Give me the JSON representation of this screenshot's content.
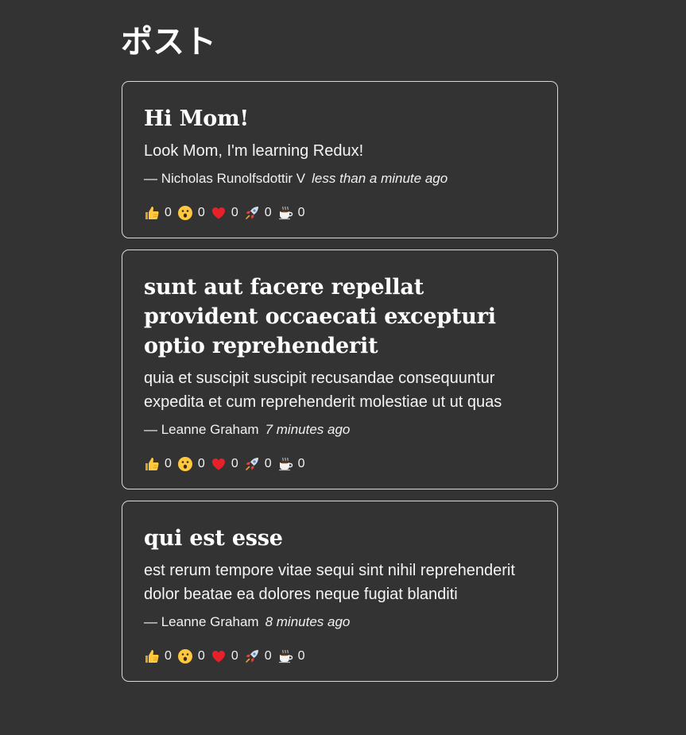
{
  "page": {
    "title": "ポスト"
  },
  "posts": [
    {
      "title": "Hi Mom!",
      "body": "Look Mom, I'm learning Redux!",
      "author": "— Nicholas Runolfsdottir V",
      "time": "less than a minute ago",
      "reactions": [
        {
          "icon": "thumbs-up-icon",
          "count": "0"
        },
        {
          "icon": "surprised-face-icon",
          "count": "0"
        },
        {
          "icon": "heart-icon",
          "count": "0"
        },
        {
          "icon": "rocket-icon",
          "count": "0"
        },
        {
          "icon": "coffee-icon",
          "count": "0"
        }
      ]
    },
    {
      "title": "sunt aut facere repellat provident occaecati excepturi optio reprehenderit",
      "body": "quia et suscipit suscipit recusandae consequuntur expedita et cum reprehenderit molestiae ut ut quas",
      "author": "— Leanne Graham",
      "time": "7 minutes ago",
      "reactions": [
        {
          "icon": "thumbs-up-icon",
          "count": "0"
        },
        {
          "icon": "surprised-face-icon",
          "count": "0"
        },
        {
          "icon": "heart-icon",
          "count": "0"
        },
        {
          "icon": "rocket-icon",
          "count": "0"
        },
        {
          "icon": "coffee-icon",
          "count": "0"
        }
      ]
    },
    {
      "title": "qui est esse",
      "body": "est rerum tempore vitae sequi sint nihil reprehenderit dolor beatae ea dolores neque fugiat blanditi",
      "author": "— Leanne Graham",
      "time": "8 minutes ago",
      "reactions": [
        {
          "icon": "thumbs-up-icon",
          "count": "0"
        },
        {
          "icon": "surprised-face-icon",
          "count": "0"
        },
        {
          "icon": "heart-icon",
          "count": "0"
        },
        {
          "icon": "rocket-icon",
          "count": "0"
        },
        {
          "icon": "coffee-icon",
          "count": "0"
        }
      ]
    }
  ],
  "colors": {
    "background": "#333333",
    "card_border": "#d8d8d8",
    "text": "#f3f3f3"
  }
}
